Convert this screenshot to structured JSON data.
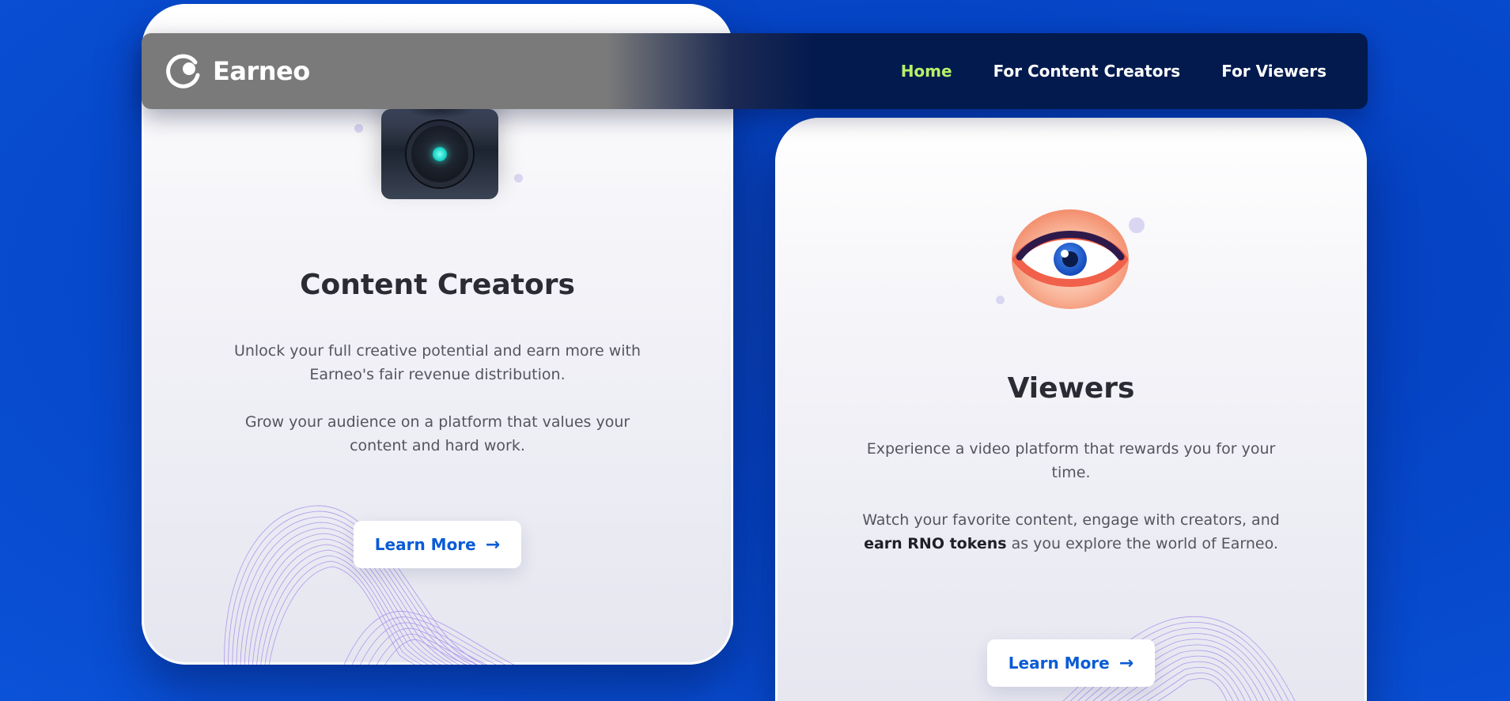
{
  "nav": {
    "brand": "Earneo",
    "links": [
      {
        "label": "Home",
        "active": true
      },
      {
        "label": "For Content Creators",
        "active": false
      },
      {
        "label": "For Viewers",
        "active": false
      }
    ],
    "active_color": "#b7f06a"
  },
  "creators_card": {
    "icon": "camera-icon",
    "title": "Content Creators",
    "paragraph1": "Unlock your full creative potential and earn more with Earneo's fair revenue distribution.",
    "paragraph2": "Grow your audience on a platform that values your content and hard work.",
    "button_label": "Learn More",
    "button_icon": "arrow-right-icon"
  },
  "viewers_card": {
    "icon": "eye-icon",
    "title": "Viewers",
    "paragraph1": "Experience a video platform that rewards you for your time.",
    "paragraph2_before": "Watch your favorite content, engage with creators, and ",
    "paragraph2_bold": "earn RNO tokens",
    "paragraph2_after": " as you explore the world of Earneo.",
    "button_label": "Learn More",
    "button_icon": "arrow-right-icon"
  },
  "colors": {
    "background": "#0543c4",
    "accent_link": "#0a5bd6",
    "nav_dark": "#021a4e"
  }
}
